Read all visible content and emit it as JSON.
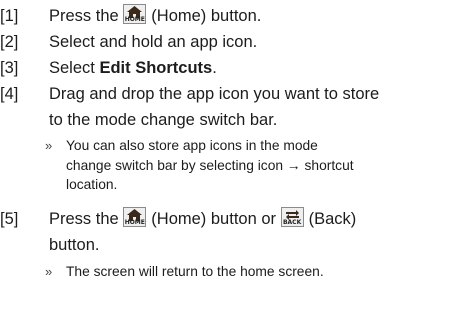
{
  "steps": [
    {
      "num": "[1]",
      "before": "Press the",
      "icon_caption": "HOME",
      "after": "(Home) button."
    },
    {
      "num": "[2]",
      "text": "Select and hold an app icon."
    },
    {
      "num": "[3]",
      "before": "Select ",
      "bold": "Edit Shortcuts",
      "after": "."
    },
    {
      "num": "[4]",
      "line1": "Drag and drop the app icon you want to store",
      "line2": "to the mode change switch bar."
    },
    {
      "num": "[5]",
      "before": "Press the",
      "icon1_caption": "HOME",
      "middle": "(Home) button or",
      "icon2_caption": "BACK",
      "after": "(Back)",
      "line2": "button."
    }
  ],
  "notes": {
    "marker": "»",
    "note1_line1": "You can also store app icons in the mode",
    "note1_line2": "change switch bar by selecting icon → shortcut",
    "note1_line3": "location.",
    "note2": "The screen will return to the home screen."
  },
  "icons": {
    "home": "home-icon",
    "back": "back-arrow-icon"
  }
}
